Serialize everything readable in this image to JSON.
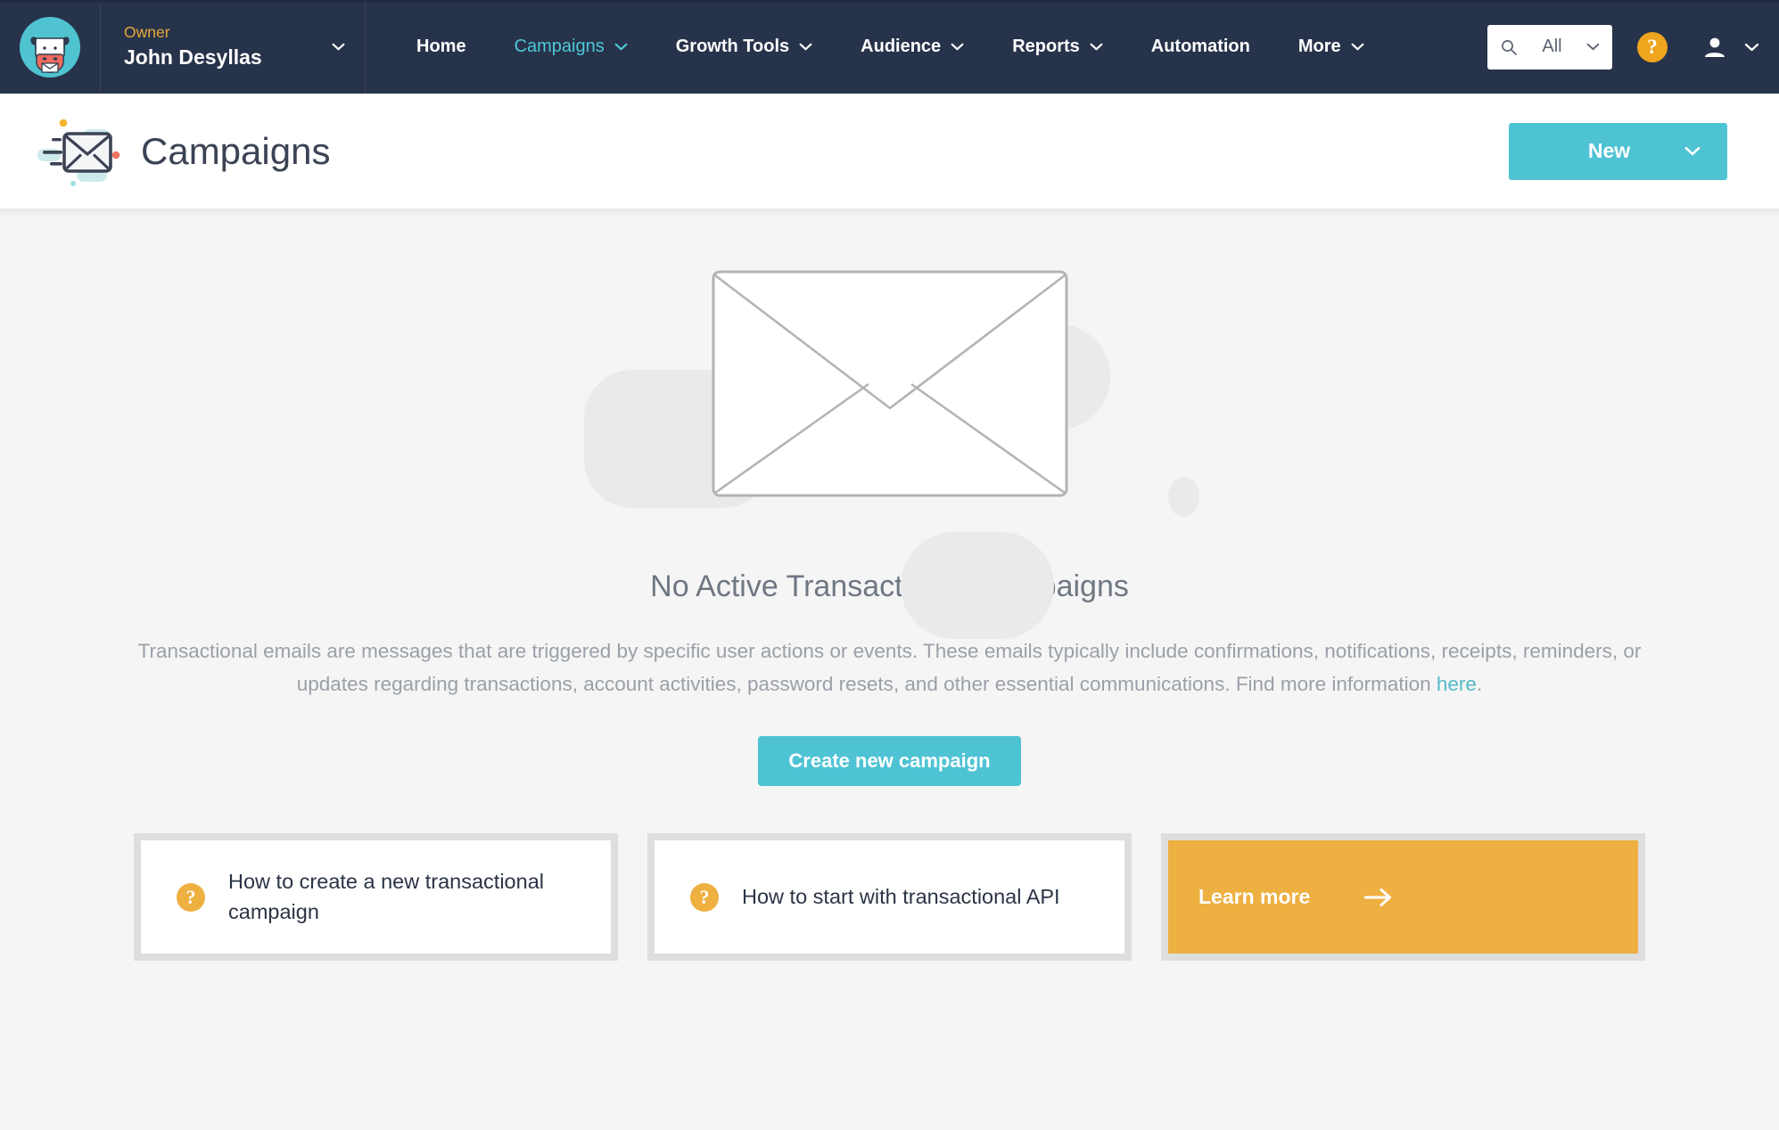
{
  "theme": {
    "navbar_bg": "#27334a",
    "accent_teal": "#4ec3d4",
    "accent_amber": "#edb041",
    "page_bg": "#f5f5f5",
    "link_teal": "#53b9c9",
    "role_amber": "#e8a93a",
    "muted_text": "#9aa0a8"
  },
  "topnav": {
    "account": {
      "role": "Owner",
      "name": "John Desyllas",
      "avatar_icon": "cow-envelope-avatar-icon",
      "caret_icon": "chevron-down-icon"
    },
    "items": [
      {
        "label": "Home",
        "has_caret": false,
        "active": false
      },
      {
        "label": "Campaigns",
        "has_caret": true,
        "active": true
      },
      {
        "label": "Growth Tools",
        "has_caret": true,
        "active": false
      },
      {
        "label": "Audience",
        "has_caret": true,
        "active": false
      },
      {
        "label": "Reports",
        "has_caret": true,
        "active": false
      },
      {
        "label": "Automation",
        "has_caret": false,
        "active": false
      },
      {
        "label": "More",
        "has_caret": true,
        "active": false
      }
    ],
    "search": {
      "icon": "search-icon",
      "scope_value": "All",
      "caret_icon": "chevron-down-icon"
    },
    "help": {
      "label": "?",
      "icon": "help-question-icon"
    },
    "user": {
      "icon": "person-icon",
      "caret_icon": "chevron-down-icon"
    }
  },
  "pagehead": {
    "icon": "flying-envelope-icon",
    "title": "Campaigns",
    "new_button": {
      "label": "New",
      "caret_icon": "chevron-down-icon"
    }
  },
  "main": {
    "hero_icon": "large-envelope-outline-icon",
    "empty_title": "No Active Transactional Campaigns",
    "empty_body_before": "Transactional emails are messages that are triggered by specific user actions or events. These emails typically include confirmations, notifications, receipts, reminders, or updates regarding transactions, account activities, password resets, and other essential communications. Find more information ",
    "empty_body_link": "here",
    "empty_body_after": ".",
    "create_button": "Create new campaign"
  },
  "cards": [
    {
      "style": "white",
      "icon": "help-question-icon",
      "label": "How to create a new transactional campaign"
    },
    {
      "style": "white",
      "icon": "help-question-icon",
      "label": "How to start with transactional API"
    },
    {
      "style": "amber",
      "label": "Learn more",
      "arrow_icon": "arrow-right-icon"
    }
  ]
}
